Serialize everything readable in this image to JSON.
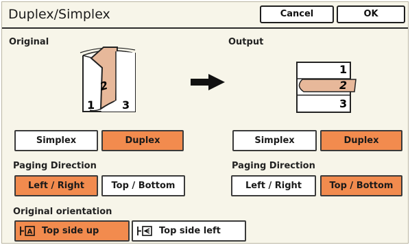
{
  "title": "Duplex/Simplex",
  "header": {
    "cancel_label": "Cancel",
    "ok_label": "OK"
  },
  "original": {
    "label": "Original",
    "page_numbers": {
      "left": "1",
      "middle": "2",
      "right": "3"
    },
    "simplex_label": "Simplex",
    "duplex_label": "Duplex",
    "paging_label": "Paging Direction",
    "left_right_label": "Left / Right",
    "top_bottom_label": "Top / Bottom"
  },
  "output": {
    "label": "Output",
    "page_numbers": {
      "top": "1",
      "middle": "2",
      "bottom": "3"
    },
    "simplex_label": "Simplex",
    "duplex_label": "Duplex",
    "paging_label": "Paging Direction",
    "left_right_label": "Left / Right",
    "top_bottom_label": "Top / Bottom"
  },
  "orientation": {
    "label": "Original orientation",
    "top_up_label": "Top side up",
    "top_left_label": "Top side left"
  },
  "colors": {
    "accent": "#f28b4e",
    "panel": "#f7f5e9",
    "page_fill": "#e7b89a"
  }
}
